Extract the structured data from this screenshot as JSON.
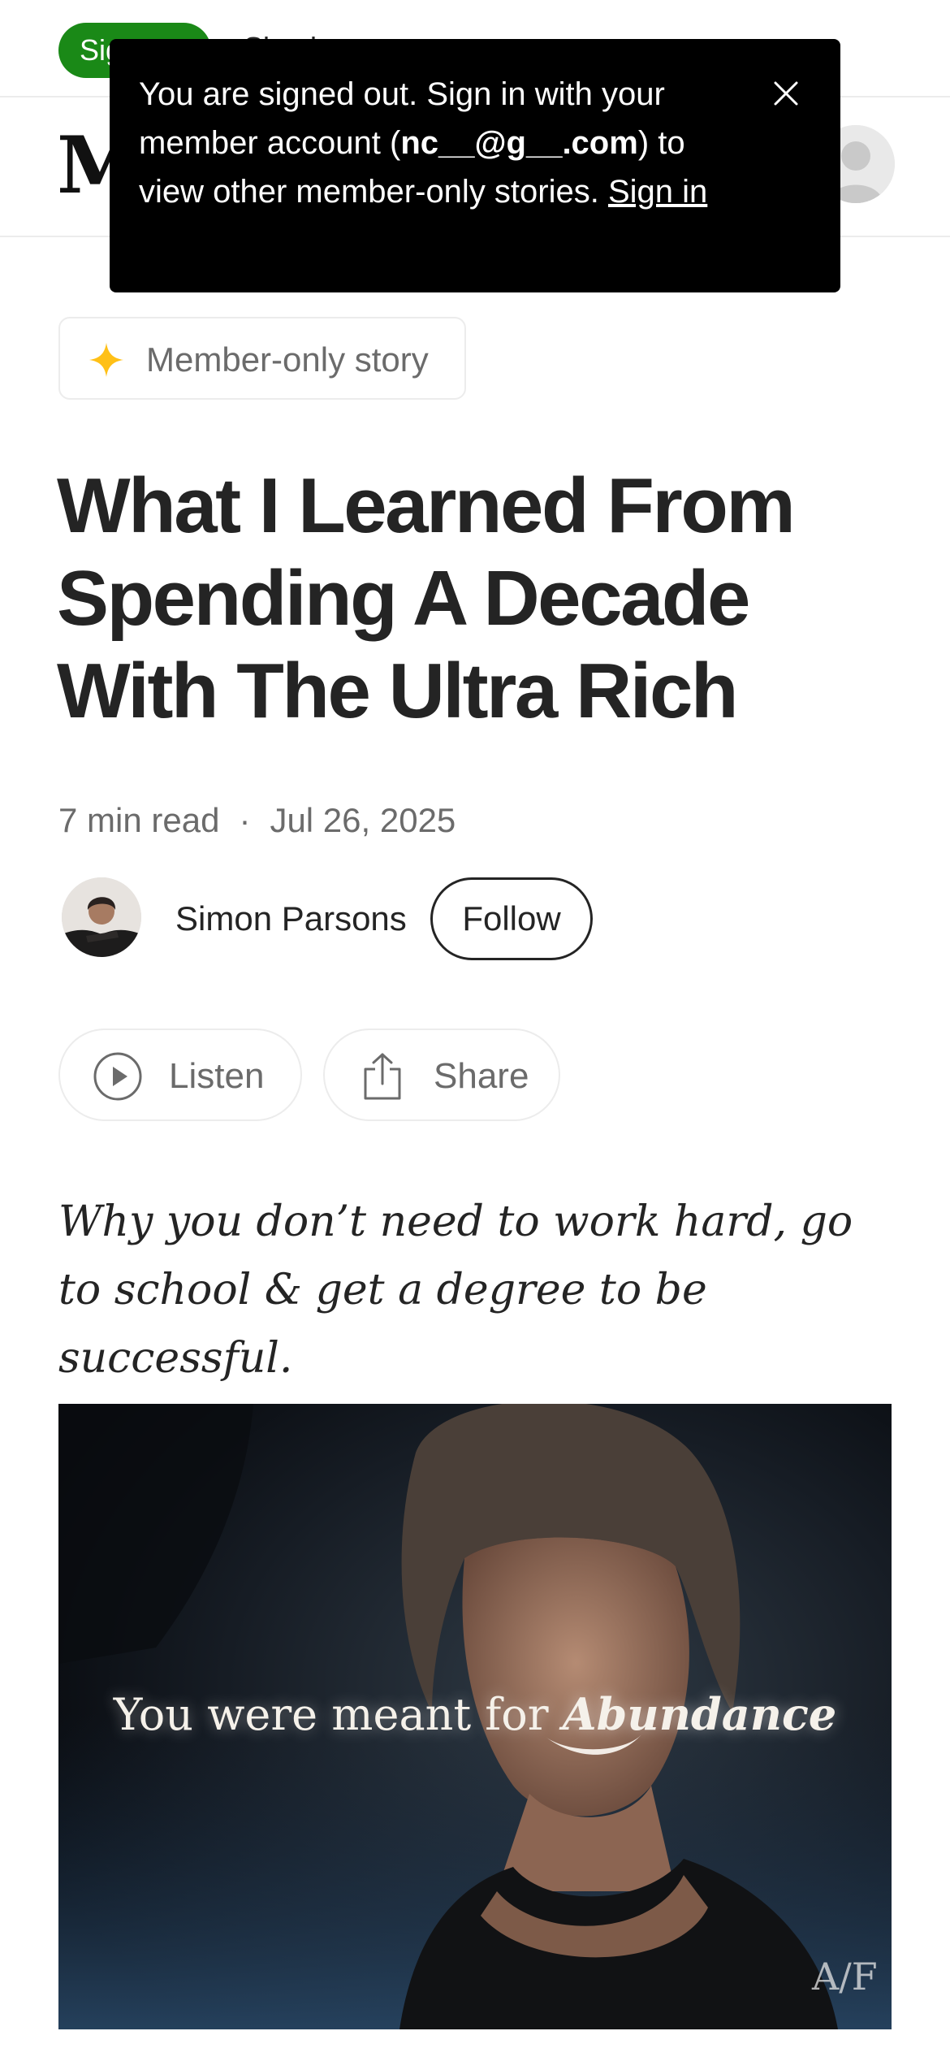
{
  "topbar": {
    "signup_label": "Sign up",
    "signin_label": "Sign in"
  },
  "header": {
    "logo_text": "M"
  },
  "toast": {
    "text_before": "You are signed out. Sign in with your member account (",
    "email": "nc__@g__.com",
    "text_after": ") to view other member-only stories. ",
    "link_label": "Sign in"
  },
  "article": {
    "badge": "Member-only story",
    "title": "What I Learned From Spending A Decade With The Ultra Rich",
    "read_time": "7 min read",
    "separator": "·",
    "date": "Jul 26, 2025",
    "author": "Simon Parsons",
    "follow_label": "Follow",
    "listen_label": "Listen",
    "share_label": "Share",
    "subtitle": "Why you don’t need to work hard, go to school & get a degree to be successful.",
    "image": {
      "caption_plain": "You were meant for ",
      "caption_emphasis": "Abundance",
      "watermark": "A/F"
    }
  },
  "colors": {
    "accent_green": "#1a8917",
    "star_yellow": "#ffc017",
    "text_primary": "#242424",
    "text_secondary": "#6b6b6b",
    "toast_bg": "#000000"
  }
}
